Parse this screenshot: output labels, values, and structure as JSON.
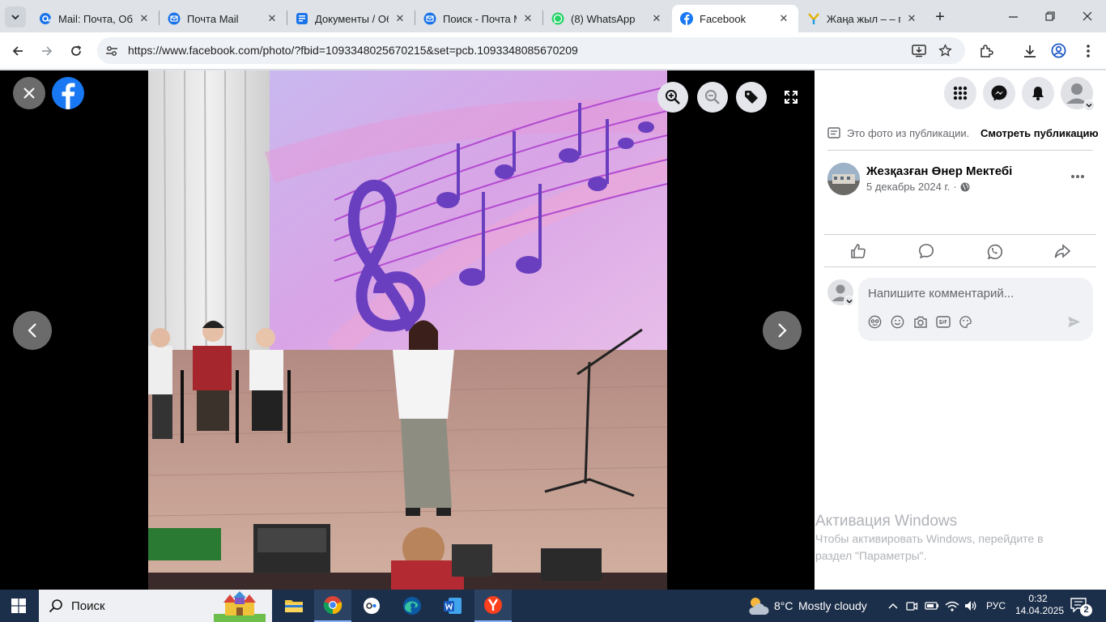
{
  "tabs": [
    {
      "title": "Mail: Почта, Обл",
      "icon": "at-icon",
      "color": "#1a73e8"
    },
    {
      "title": "Почта Mail",
      "icon": "mail-icon",
      "color": "#1a73e8"
    },
    {
      "title": "Документы / Об",
      "icon": "doc-icon",
      "color": "#1a73e8"
    },
    {
      "title": "Поиск - Почта М",
      "icon": "mail-icon",
      "color": "#1a73e8"
    },
    {
      "title": "(8) WhatsApp",
      "icon": "whatsapp-icon",
      "color": "#25d366"
    },
    {
      "title": "Facebook",
      "icon": "facebook-icon",
      "color": "#1877f2",
      "active": true
    },
    {
      "title": "Жаңа жыл – – п",
      "icon": "yandex-icon",
      "color": "#fc3f1d"
    }
  ],
  "address": {
    "url": "https://www.facebook.com/photo/?fbid=1093348025670215&set=pcb.1093348085670209"
  },
  "post": {
    "note": "Это фото из публикации.",
    "view_post": "Смотреть публикацию",
    "author": "Жезқазған Өнер Мектебі",
    "date": "5 декабрь 2024 г.",
    "comment_placeholder": "Напишите комментарий..."
  },
  "watermark": {
    "title": "Активация Windows",
    "line1": "Чтобы активировать Windows, перейдите в",
    "line2": "раздел \"Параметры\"."
  },
  "taskbar": {
    "search_label": "Поиск",
    "weather_temp": "8°C",
    "weather_text": "Mostly cloudy",
    "lang": "РУС",
    "time": "0:32",
    "date": "14.04.2025",
    "notifications": "2"
  },
  "colors": {
    "facebook_blue": "#1877f2",
    "taskbar_bg": "#1c2f4a"
  }
}
